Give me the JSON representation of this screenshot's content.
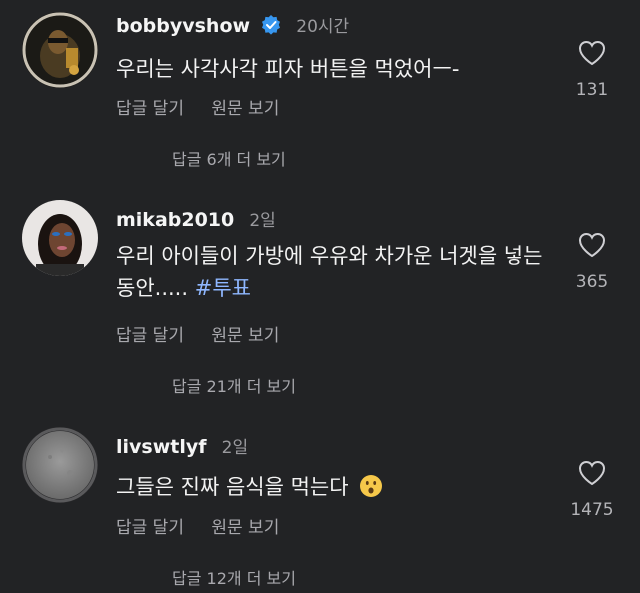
{
  "comments": [
    {
      "username": "bobbyvshow",
      "verified": true,
      "time": "20시간",
      "text": "우리는 사각사각 피자 버튼을 먹었어ㅡ-",
      "hashtag": "",
      "reply_label": "답글 달기",
      "translate_label": "원문 보기",
      "likes": "131",
      "more_replies": "답글 6개 더 보기"
    },
    {
      "username": "mikab2010",
      "verified": false,
      "time": "2일",
      "text": "우리 아이들이 가방에 우유와 차가운 너겟을 넣는 동안.....",
      "hashtag": "#투표",
      "reply_label": "답글 달기",
      "translate_label": "원문 보기",
      "likes": "365",
      "more_replies": "답글 21개 더 보기"
    },
    {
      "username": "livswtlyf",
      "verified": false,
      "time": "2일",
      "text": "그들은 진짜 음식을 먹는다",
      "hashtag": "",
      "reply_label": "답글 달기",
      "translate_label": "원문 보기",
      "likes": "1475",
      "more_replies": "답글 12개 더 보기"
    }
  ],
  "colors": {
    "background": "#222325",
    "verified": "#3797f0",
    "hashtag": "#8fb7ff",
    "muted": "#a8a8ad"
  }
}
